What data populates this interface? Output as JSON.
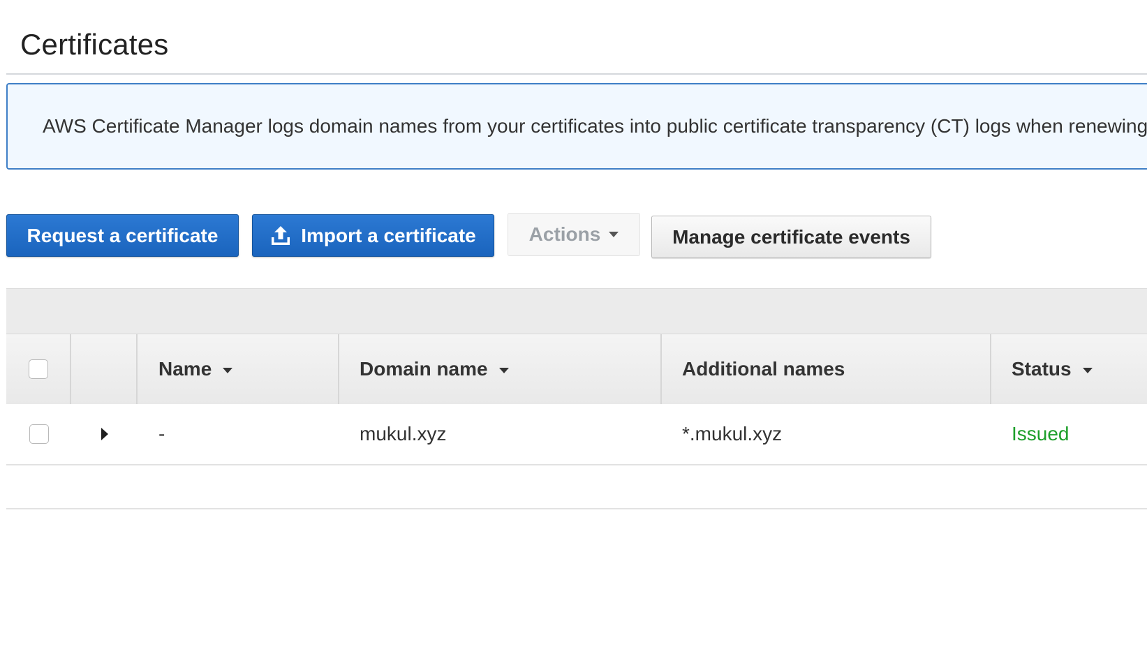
{
  "page": {
    "title": "Certificates"
  },
  "info_banner": {
    "text": "AWS Certificate Manager logs domain names from your certificates into public certificate transparency (CT) logs when renewing"
  },
  "toolbar": {
    "request_label": "Request a certificate",
    "import_label": "Import a certificate",
    "actions_label": "Actions",
    "manage_events_label": "Manage certificate events"
  },
  "table": {
    "columns": {
      "name": "Name",
      "domain_name": "Domain name",
      "additional_names": "Additional names",
      "status": "Status"
    },
    "rows": [
      {
        "name": "-",
        "domain_name": "mukul.xyz",
        "additional_names": "*.mukul.xyz",
        "status": "Issued"
      }
    ]
  },
  "colors": {
    "primary_button": "#1a64bd",
    "banner_border": "#3f7fc7",
    "banner_background": "#f1f8ff",
    "status_issued": "#1d9f2a"
  },
  "icons": {
    "import": "upload-icon",
    "dropdown": "caret-down-icon",
    "expand": "caret-right-icon"
  }
}
